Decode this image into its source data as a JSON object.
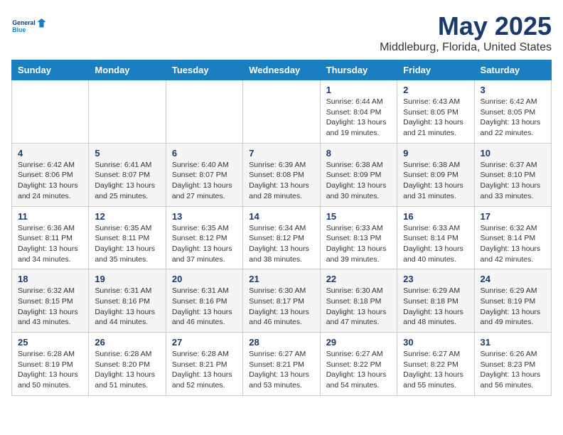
{
  "logo": {
    "line1": "General",
    "line2": "Blue"
  },
  "title": "May 2025",
  "location": "Middleburg, Florida, United States",
  "days_of_week": [
    "Sunday",
    "Monday",
    "Tuesday",
    "Wednesday",
    "Thursday",
    "Friday",
    "Saturday"
  ],
  "weeks": [
    [
      {
        "day": "",
        "info": ""
      },
      {
        "day": "",
        "info": ""
      },
      {
        "day": "",
        "info": ""
      },
      {
        "day": "",
        "info": ""
      },
      {
        "day": "1",
        "info": "Sunrise: 6:44 AM\nSunset: 8:04 PM\nDaylight: 13 hours\nand 19 minutes."
      },
      {
        "day": "2",
        "info": "Sunrise: 6:43 AM\nSunset: 8:05 PM\nDaylight: 13 hours\nand 21 minutes."
      },
      {
        "day": "3",
        "info": "Sunrise: 6:42 AM\nSunset: 8:05 PM\nDaylight: 13 hours\nand 22 minutes."
      }
    ],
    [
      {
        "day": "4",
        "info": "Sunrise: 6:42 AM\nSunset: 8:06 PM\nDaylight: 13 hours\nand 24 minutes."
      },
      {
        "day": "5",
        "info": "Sunrise: 6:41 AM\nSunset: 8:07 PM\nDaylight: 13 hours\nand 25 minutes."
      },
      {
        "day": "6",
        "info": "Sunrise: 6:40 AM\nSunset: 8:07 PM\nDaylight: 13 hours\nand 27 minutes."
      },
      {
        "day": "7",
        "info": "Sunrise: 6:39 AM\nSunset: 8:08 PM\nDaylight: 13 hours\nand 28 minutes."
      },
      {
        "day": "8",
        "info": "Sunrise: 6:38 AM\nSunset: 8:09 PM\nDaylight: 13 hours\nand 30 minutes."
      },
      {
        "day": "9",
        "info": "Sunrise: 6:38 AM\nSunset: 8:09 PM\nDaylight: 13 hours\nand 31 minutes."
      },
      {
        "day": "10",
        "info": "Sunrise: 6:37 AM\nSunset: 8:10 PM\nDaylight: 13 hours\nand 33 minutes."
      }
    ],
    [
      {
        "day": "11",
        "info": "Sunrise: 6:36 AM\nSunset: 8:11 PM\nDaylight: 13 hours\nand 34 minutes."
      },
      {
        "day": "12",
        "info": "Sunrise: 6:35 AM\nSunset: 8:11 PM\nDaylight: 13 hours\nand 35 minutes."
      },
      {
        "day": "13",
        "info": "Sunrise: 6:35 AM\nSunset: 8:12 PM\nDaylight: 13 hours\nand 37 minutes."
      },
      {
        "day": "14",
        "info": "Sunrise: 6:34 AM\nSunset: 8:12 PM\nDaylight: 13 hours\nand 38 minutes."
      },
      {
        "day": "15",
        "info": "Sunrise: 6:33 AM\nSunset: 8:13 PM\nDaylight: 13 hours\nand 39 minutes."
      },
      {
        "day": "16",
        "info": "Sunrise: 6:33 AM\nSunset: 8:14 PM\nDaylight: 13 hours\nand 40 minutes."
      },
      {
        "day": "17",
        "info": "Sunrise: 6:32 AM\nSunset: 8:14 PM\nDaylight: 13 hours\nand 42 minutes."
      }
    ],
    [
      {
        "day": "18",
        "info": "Sunrise: 6:32 AM\nSunset: 8:15 PM\nDaylight: 13 hours\nand 43 minutes."
      },
      {
        "day": "19",
        "info": "Sunrise: 6:31 AM\nSunset: 8:16 PM\nDaylight: 13 hours\nand 44 minutes."
      },
      {
        "day": "20",
        "info": "Sunrise: 6:31 AM\nSunset: 8:16 PM\nDaylight: 13 hours\nand 46 minutes."
      },
      {
        "day": "21",
        "info": "Sunrise: 6:30 AM\nSunset: 8:17 PM\nDaylight: 13 hours\nand 46 minutes."
      },
      {
        "day": "22",
        "info": "Sunrise: 6:30 AM\nSunset: 8:18 PM\nDaylight: 13 hours\nand 47 minutes."
      },
      {
        "day": "23",
        "info": "Sunrise: 6:29 AM\nSunset: 8:18 PM\nDaylight: 13 hours\nand 48 minutes."
      },
      {
        "day": "24",
        "info": "Sunrise: 6:29 AM\nSunset: 8:19 PM\nDaylight: 13 hours\nand 49 minutes."
      }
    ],
    [
      {
        "day": "25",
        "info": "Sunrise: 6:28 AM\nSunset: 8:19 PM\nDaylight: 13 hours\nand 50 minutes."
      },
      {
        "day": "26",
        "info": "Sunrise: 6:28 AM\nSunset: 8:20 PM\nDaylight: 13 hours\nand 51 minutes."
      },
      {
        "day": "27",
        "info": "Sunrise: 6:28 AM\nSunset: 8:21 PM\nDaylight: 13 hours\nand 52 minutes."
      },
      {
        "day": "28",
        "info": "Sunrise: 6:27 AM\nSunset: 8:21 PM\nDaylight: 13 hours\nand 53 minutes."
      },
      {
        "day": "29",
        "info": "Sunrise: 6:27 AM\nSunset: 8:22 PM\nDaylight: 13 hours\nand 54 minutes."
      },
      {
        "day": "30",
        "info": "Sunrise: 6:27 AM\nSunset: 8:22 PM\nDaylight: 13 hours\nand 55 minutes."
      },
      {
        "day": "31",
        "info": "Sunrise: 6:26 AM\nSunset: 8:23 PM\nDaylight: 13 hours\nand 56 minutes."
      }
    ]
  ]
}
